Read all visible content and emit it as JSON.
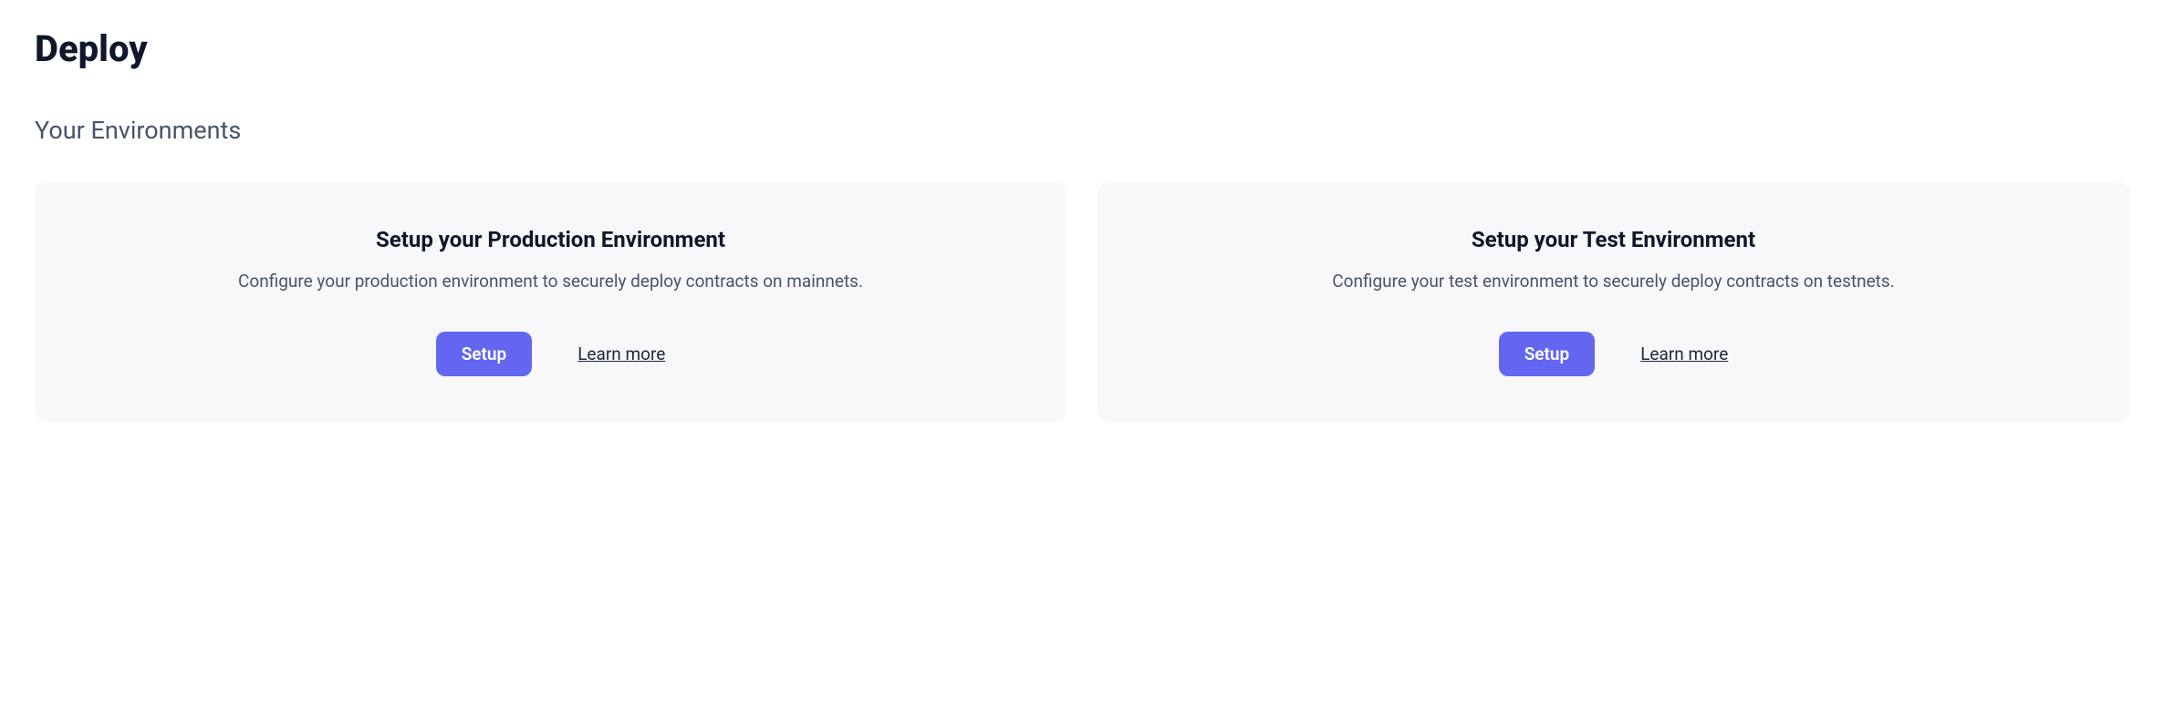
{
  "page": {
    "title": "Deploy",
    "section_title": "Your Environments"
  },
  "environments": [
    {
      "title": "Setup your Production Environment",
      "description": "Configure your production environment to securely deploy contracts on mainnets.",
      "setup_label": "Setup",
      "learn_more_label": "Learn more"
    },
    {
      "title": "Setup your Test Environment",
      "description": "Configure your test environment to securely deploy contracts on testnets.",
      "setup_label": "Setup",
      "learn_more_label": "Learn more"
    }
  ]
}
